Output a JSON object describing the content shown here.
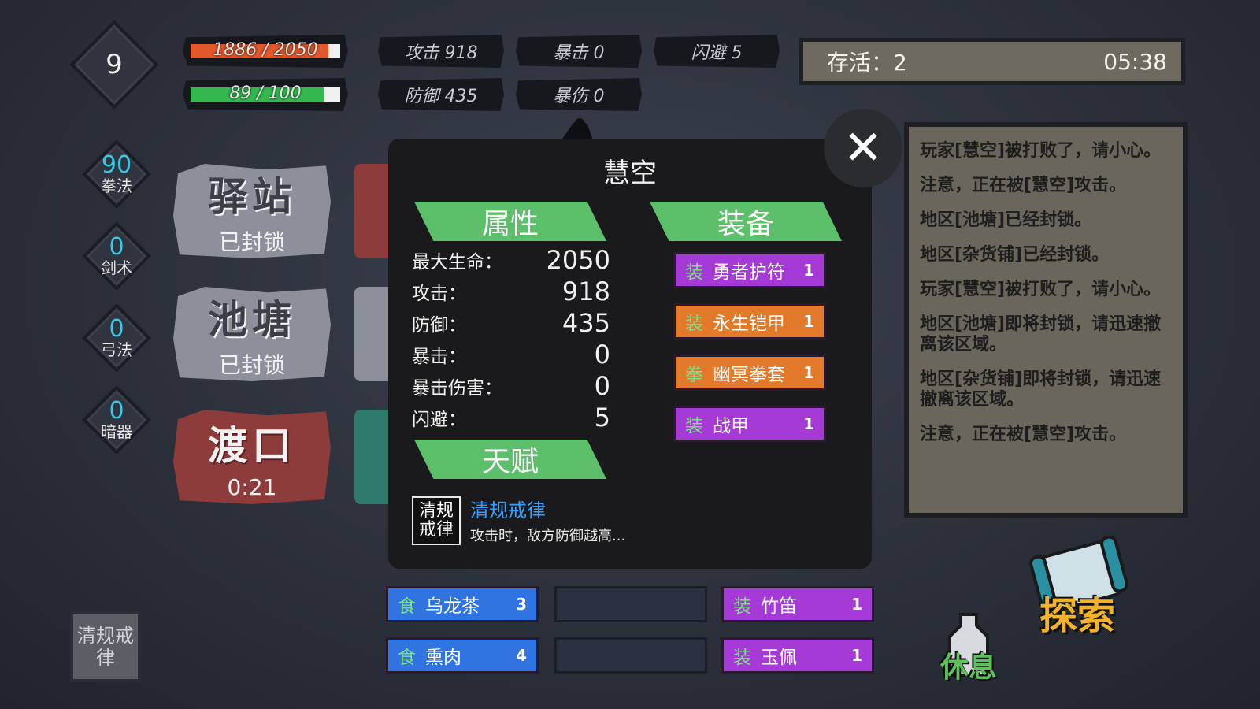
{
  "player": {
    "level": "9",
    "hp_text": "1886 / 2050",
    "hp_ratio": 0.92,
    "hp_color": "#e2572b",
    "mp_text": "89 / 100",
    "mp_ratio": 0.89,
    "mp_color": "#33b84f"
  },
  "top_stats": {
    "attack": "攻击 918",
    "crit": "暴击 0",
    "dodge": "闪避 5",
    "defense": "防御 435",
    "crit_dmg": "暴伤 0"
  },
  "survive": {
    "label": "存活：2",
    "timer": "05:38"
  },
  "skills": [
    {
      "value": "90",
      "name": "拳法"
    },
    {
      "value": "0",
      "name": "剑术"
    },
    {
      "value": "0",
      "name": "弓法"
    },
    {
      "value": "0",
      "name": "暗器"
    }
  ],
  "locations": [
    {
      "title": "驿站",
      "status": "已封锁",
      "color": "#8b909a"
    },
    {
      "title": "池塘",
      "status": "已封锁",
      "color": "#8b909a"
    },
    {
      "title": "渡口",
      "status": "0:21",
      "color": "#8e3b3b"
    }
  ],
  "modal": {
    "title": "慧空",
    "attr_header": "属性",
    "equip_header": "装备",
    "talent_header": "天赋",
    "stats": [
      {
        "label": "最大生命：",
        "value": "2050"
      },
      {
        "label": "攻击：",
        "value": "918"
      },
      {
        "label": "防御：",
        "value": "435"
      },
      {
        "label": "暴击：",
        "value": "0"
      },
      {
        "label": "暴击伤害：",
        "value": "0"
      },
      {
        "label": "闪避：",
        "value": "5"
      }
    ],
    "equipment": [
      {
        "cat": "装",
        "name": "勇者护符",
        "qty": "1",
        "color": "purple"
      },
      {
        "cat": "装",
        "name": "永生铠甲",
        "qty": "1",
        "color": "orange"
      },
      {
        "cat": "拳",
        "name": "幽冥拳套",
        "qty": "1",
        "color": "orange"
      },
      {
        "cat": "装",
        "name": "战甲",
        "qty": "1",
        "color": "purple"
      }
    ],
    "talent": {
      "icon_text": "清规戒律",
      "name": "清规戒律",
      "desc": "攻击时，敌方防御越高..."
    },
    "close_icon": "close-icon"
  },
  "log": [
    "玩家[慧空]被打败了，请小心。",
    "注意，正在被[慧空]攻击。",
    "地区[池塘]已经封锁。",
    "地区[杂货铺]已经封锁。",
    "玩家[慧空]被打败了，请小心。",
    "地区[池塘]即将封锁，请迅速撤离该区域。",
    "地区[杂货铺]即将封锁，请迅速撤离该区域。",
    "注意，正在被[慧空]攻击。"
  ],
  "inventory": {
    "food": [
      {
        "cat": "食",
        "name": "乌龙茶",
        "qty": "3"
      },
      {
        "cat": "食",
        "name": "熏肉",
        "qty": "4"
      }
    ],
    "equip": [
      {
        "cat": "装",
        "name": "竹笛",
        "qty": "1"
      },
      {
        "cat": "装",
        "name": "玉佩",
        "qty": "1"
      }
    ]
  },
  "talent_chip": "清规戒律",
  "actions": {
    "rest": "休息",
    "explore": "探索"
  }
}
